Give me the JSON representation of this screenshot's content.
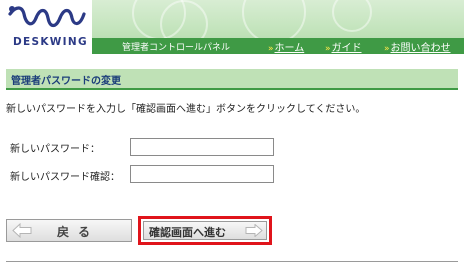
{
  "header": {
    "brand": "DESKWING",
    "panel_title": "管理者コントロールパネル",
    "nav": [
      {
        "label": "ホーム"
      },
      {
        "label": "ガイド"
      },
      {
        "label": "お問い合わせ"
      }
    ]
  },
  "section": {
    "title": "管理者パスワードの変更",
    "instruction": "新しいパスワードを入力し「確認画面へ進む」ボタンをクリックしてください。"
  },
  "form": {
    "new_password_label": "新しいパスワード：",
    "new_password_value": "",
    "confirm_password_label": "新しいパスワード確認：",
    "confirm_password_value": ""
  },
  "buttons": {
    "back_label": "戻る",
    "back_icon": "arrow-left-icon",
    "confirm_label": "確認画面へ進む",
    "confirm_icon": "arrow-right-icon"
  },
  "colors": {
    "header_green": "#3f9a45",
    "section_bg": "#bfe1b6",
    "highlight_red": "#e0141b",
    "brand_blue": "#2c3a86"
  }
}
